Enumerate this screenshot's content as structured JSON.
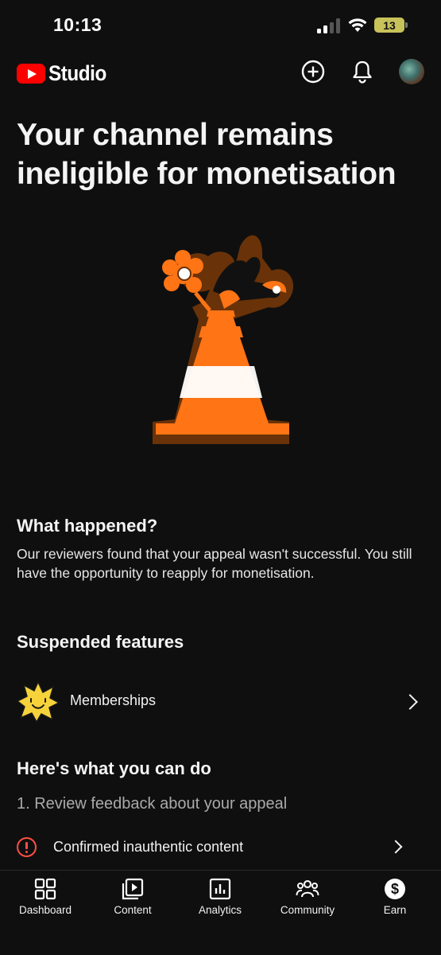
{
  "status_bar": {
    "time": "10:13",
    "battery_level": "13",
    "signal_bars": 2,
    "battery_color": "#c8c25a"
  },
  "header": {
    "brand": "Studio",
    "brand_color": "#ff0000",
    "icons": [
      "create-icon",
      "bell-icon",
      "avatar"
    ]
  },
  "page": {
    "title": "Your channel remains ineligible for monetisation",
    "what_happened": {
      "heading": "What happened?",
      "body": "Our reviewers found that your appeal wasn't successful. You still have the opportunity to reapply for monetisation."
    },
    "suspended_features": {
      "heading": "Suspended features",
      "items": [
        {
          "label": "Memberships",
          "icon": "star-badge-icon"
        }
      ]
    },
    "what_you_can_do": {
      "heading": "Here's what you can do",
      "step_1": "1. Review feedback about your appeal",
      "issues": [
        {
          "label": "Confirmed inauthentic content",
          "icon": "alert-circle-icon",
          "color": "#ff4e45"
        }
      ]
    }
  },
  "bottom_nav": {
    "items": [
      {
        "label": "Dashboard",
        "icon": "dashboard-icon"
      },
      {
        "label": "Content",
        "icon": "content-icon"
      },
      {
        "label": "Analytics",
        "icon": "analytics-icon"
      },
      {
        "label": "Community",
        "icon": "community-icon"
      },
      {
        "label": "Earn",
        "icon": "earn-icon"
      }
    ]
  }
}
